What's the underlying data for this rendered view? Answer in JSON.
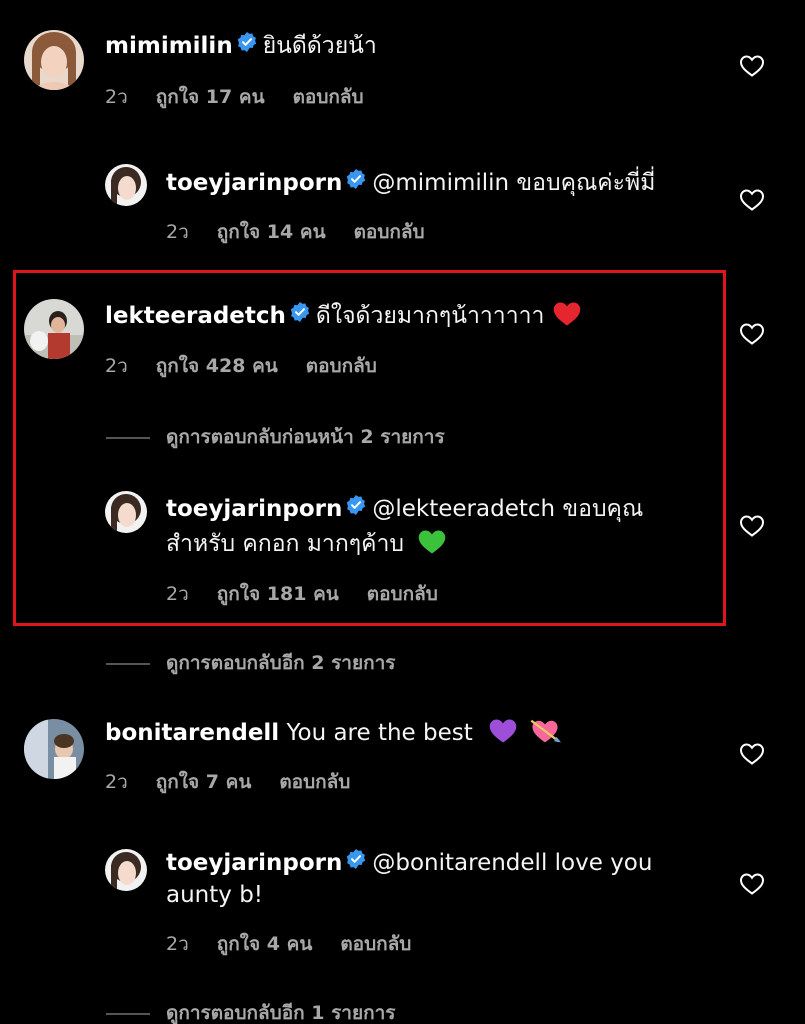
{
  "comments": [
    {
      "username": "mimimilin",
      "text": "ยินดีด้วยน้า",
      "time": "2ว",
      "likes": "ถูกใจ 17 คน",
      "reply": "ตอบกลับ"
    },
    {
      "username": "toeyjarinporn",
      "mention": "@mimimilin",
      "text": " ขอบคุณค่ะพี่มี่",
      "time": "2ว",
      "likes": "ถูกใจ 14 คน",
      "reply": "ตอบกลับ"
    },
    {
      "username": "lekteeradetch",
      "text": "ดีใจด้วยมากๆน้าาาาาา",
      "time": "2ว",
      "likes": "ถูกใจ 428 คน",
      "reply": "ตอบกลับ"
    },
    {
      "username": "toeyjarinporn",
      "mention": "@lekteeradetch",
      "text": " ขอบคุณ",
      "text_line2": "สำหรับ คกอก มากๆค้าบ",
      "time": "2ว",
      "likes": "ถูกใจ 181 คน",
      "reply": "ตอบกลับ"
    },
    {
      "username": "bonitarendell",
      "text": "You are the best",
      "time": "2ว",
      "likes": "ถูกใจ 7 คน",
      "reply": "ตอบกลับ"
    },
    {
      "username": "toeyjarinporn",
      "mention": "@bonitarendell",
      "text": " love you",
      "text_line2": "aunty b!",
      "time": "2ว",
      "likes": "ถูกใจ 4 คน",
      "reply": "ตอบกลับ"
    }
  ],
  "view_more": {
    "previous_replies": "ดูการตอบกลับก่อนหน้า 2 รายการ",
    "more_replies_2": "ดูการตอบกลับอีก 2 รายการ",
    "more_replies_1": "ดูการตอบกลับอีก 1 รายการ"
  },
  "colors": {
    "background": "#000000",
    "secondary_text": "#a8a8a8",
    "verified_blue": "#3897f0",
    "highlight_border": "#e0151b"
  },
  "icons": {
    "verified": "verified-badge-icon",
    "like": "heart-outline-icon"
  }
}
